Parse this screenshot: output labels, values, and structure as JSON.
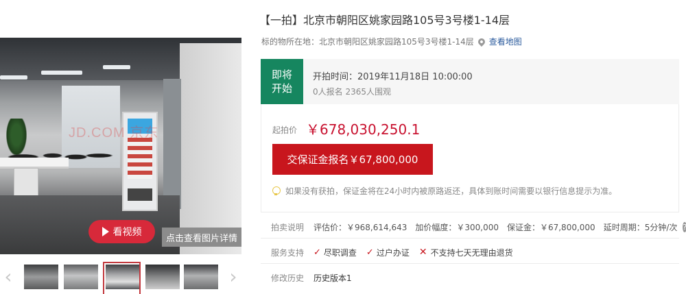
{
  "gallery": {
    "watermark": "JD.COM 京东",
    "video_label": "看视频",
    "detail_label": "点击查看图片详情",
    "prev_arrow": "‹",
    "next_arrow": "›",
    "selected_thumb_index": 3
  },
  "header": {
    "title": "【一拍】北京市朝阳区姚家园路105号3号楼1-14层",
    "location_label": "标的物所在地：北京市朝阳区姚家园路105号3号楼1-14层",
    "map_link": "查看地图"
  },
  "status": {
    "badge_line1": "即将",
    "badge_line2": "开始",
    "start_time": "开拍时间：2019年11月18日 10:00:00",
    "counts": "0人报名   2365人围观",
    "badge_color": "#16865f"
  },
  "price": {
    "label": "起拍价",
    "value": "￥678,030,250.1",
    "deposit_button": "交保证金报名￥67,800,000",
    "tip": "如果没有获拍，保证金将在24小时内被原路返还，具体到账时间需要以银行信息提示为准。",
    "accent_color": "#c8161d"
  },
  "auction_info": {
    "label": "拍卖说明",
    "assessed": "评估价：￥968,614,643",
    "increment": "加价幅度：￥300,000",
    "deposit": "保证金：￥67,800,000",
    "delay": "延时周期：5分钟/次"
  },
  "services": {
    "label": "服务支持",
    "items": [
      "尽职调查",
      "过户办证",
      "不支持七天无理由退货"
    ]
  },
  "history": {
    "label": "修改历史",
    "link": "历史版本1"
  }
}
